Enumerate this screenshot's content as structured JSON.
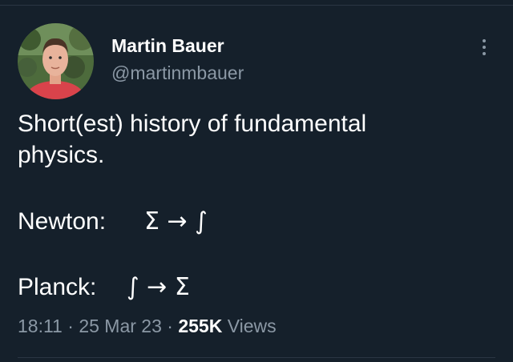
{
  "author": {
    "name": "Martin Bauer",
    "handle": "@martinmbauer"
  },
  "post": {
    "line1": "Short(est) history of fundamental",
    "line2": "physics.",
    "newton_label": "Newton:",
    "newton_formula": "Σ → ∫",
    "planck_label": "Planck:",
    "planck_formula": "∫ → Σ"
  },
  "meta": {
    "time": "18:11",
    "separator": "·",
    "date": "25 Mar 23",
    "views_count": "255K",
    "views_label": "Views"
  },
  "icons": {
    "more": "more-vertical-icon"
  },
  "colors": {
    "background": "#15202b",
    "secondary_text": "#8b98a5",
    "primary_text": "#ffffff"
  }
}
